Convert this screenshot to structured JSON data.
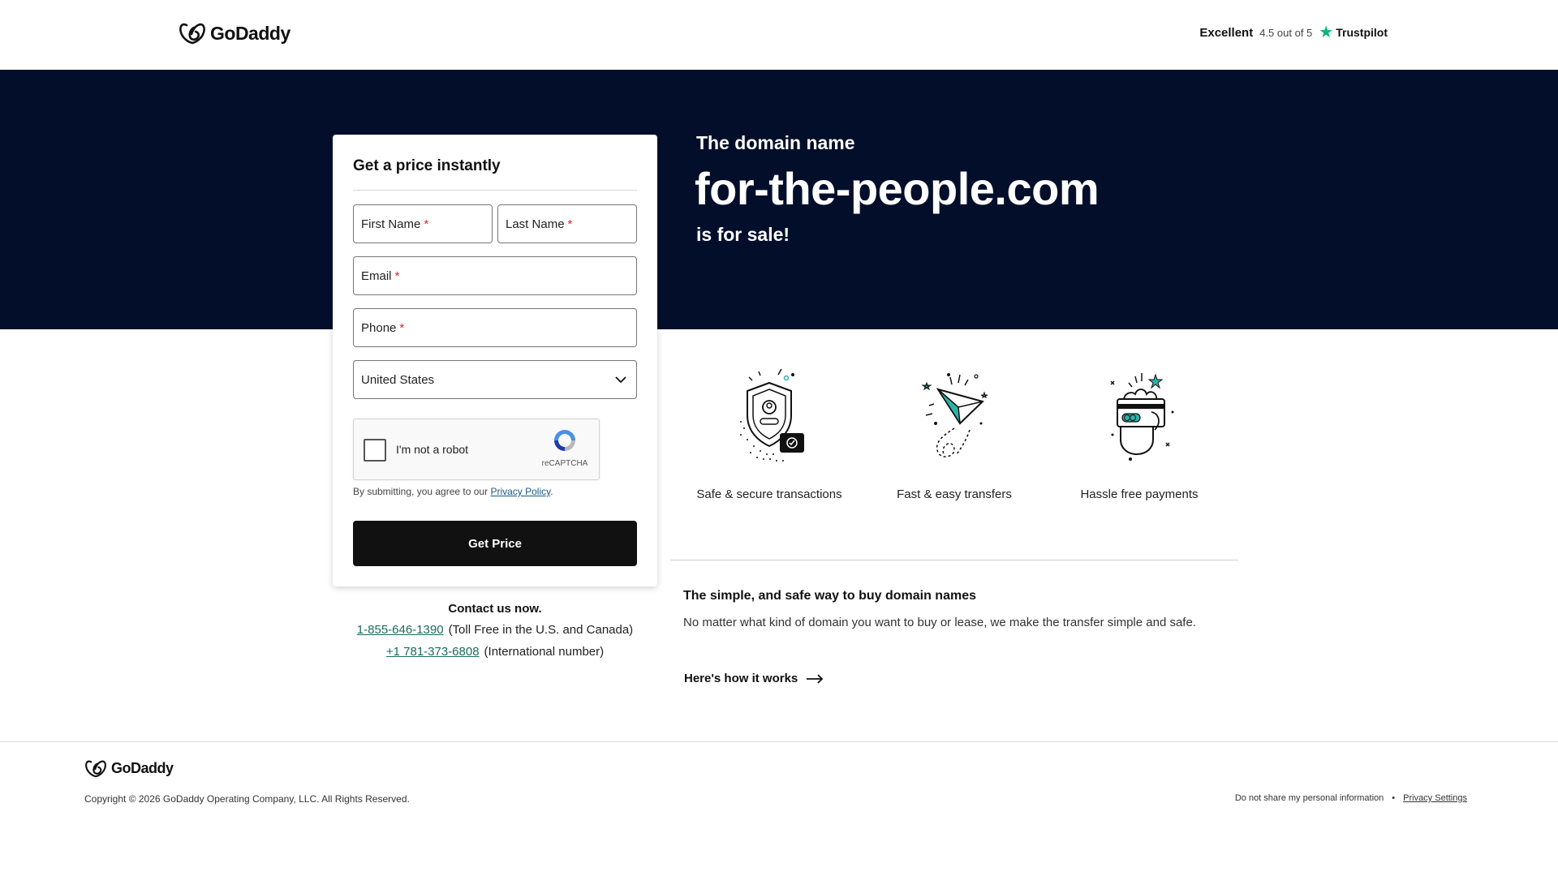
{
  "header": {
    "brand": "GoDaddy",
    "rating_word": "Excellent",
    "rating_score": "4.5 out of 5",
    "trustpilot_label": "Trustpilot",
    "trustpilot_color": "#00b67a"
  },
  "hero": {
    "pre_text": "The domain name",
    "domain": "for-the-people.com",
    "post_text": "is for sale!",
    "background": "#030f2a"
  },
  "form": {
    "title": "Get a price instantly",
    "first_name_label": "First Name",
    "last_name_label": "Last Name",
    "email_label": "Email",
    "phone_label": "Phone",
    "required_mark": "*",
    "country_value": "United States",
    "captcha_label": "I'm not a robot",
    "captcha_brand": "reCAPTCHA",
    "legal_prefix": "By submitting, you agree to our",
    "legal_link": "Privacy Policy",
    "legal_suffix": ".",
    "submit_label": "Get Price"
  },
  "contact": {
    "title": "Contact us now.",
    "phone1": "1-855-646-1390",
    "phone1_note": "(Toll Free in the U.S. and Canada)",
    "phone2": "+1 781-373-6808",
    "phone2_note": "(International number)"
  },
  "features": [
    {
      "icon": "secure-shield-icon",
      "caption": "Safe & secure transactions"
    },
    {
      "icon": "paper-plane-icon",
      "caption": "Fast & easy transfers"
    },
    {
      "icon": "payment-card-icon",
      "caption": "Hassle free payments"
    }
  ],
  "info": {
    "title": "The simple, and safe way to buy domain names",
    "body": "No matter what kind of domain you want to buy or lease, we make the transfer simple and safe.",
    "link": "Here's how it works"
  },
  "footer": {
    "brand": "GoDaddy",
    "copyright": "Copyright © 2026 GoDaddy Operating Company, LLC. All Rights Reserved.",
    "do_not_share": "Do not share my personal information",
    "separator": "•",
    "privacy_settings": "Privacy Settings"
  }
}
